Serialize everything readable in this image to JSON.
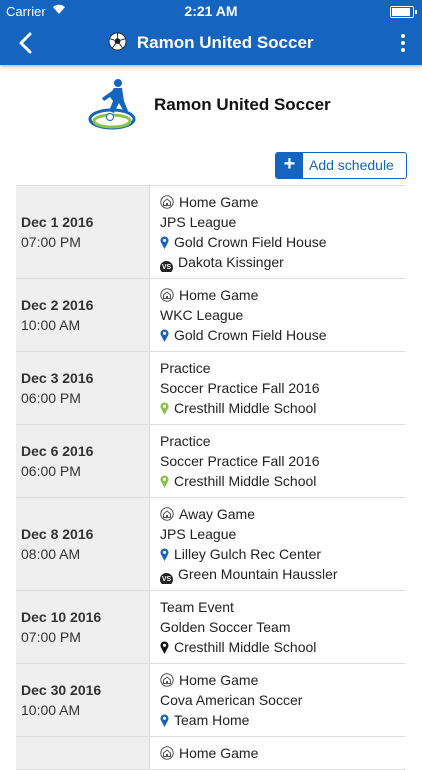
{
  "status_bar": {
    "carrier": "Carrier",
    "time": "2:21 AM"
  },
  "navbar": {
    "title": "Ramon United Soccer"
  },
  "header": {
    "team_name": "Ramon United Soccer"
  },
  "actions": {
    "add_schedule": "Add schedule",
    "add_icon": "+"
  },
  "colors": {
    "brand": "#1565c0",
    "pin_blue": "#1565c0",
    "pin_green": "#8bc34a",
    "pin_black": "#111111"
  },
  "schedule": [
    {
      "date": "Dec 1 2016",
      "time": "07:00 PM",
      "type": "Home Game",
      "type_icon": "home-game-icon",
      "league": "JPS League",
      "location": "Gold Crown Field House",
      "pin": "blue",
      "opponent": "Dakota Kissinger"
    },
    {
      "date": "Dec 2 2016",
      "time": "10:00 AM",
      "type": "Home Game",
      "type_icon": "home-game-icon",
      "league": "WKC League",
      "location": "Gold Crown Field House",
      "pin": "blue",
      "opponent": ""
    },
    {
      "date": "Dec 3 2016",
      "time": "06:00 PM",
      "type": "Practice",
      "type_icon": "",
      "league": "Soccer Practice Fall 2016",
      "location": "Cresthill Middle School",
      "pin": "green",
      "opponent": ""
    },
    {
      "date": "Dec 6 2016",
      "time": "06:00 PM",
      "type": "Practice",
      "type_icon": "",
      "league": "Soccer Practice Fall 2016",
      "location": "Cresthill Middle School",
      "pin": "green",
      "opponent": ""
    },
    {
      "date": "Dec 8 2016",
      "time": "08:00 AM",
      "type": "Away Game",
      "type_icon": "away-game-icon",
      "league": "JPS League",
      "location": "Lilley Gulch Rec Center",
      "pin": "blue",
      "opponent": "Green Mountain Haussler"
    },
    {
      "date": "Dec 10 2016",
      "time": "07:00 PM",
      "type": "Team Event",
      "type_icon": "",
      "league": "Golden Soccer Team",
      "location": "Cresthill Middle School",
      "pin": "black",
      "opponent": ""
    },
    {
      "date": "Dec 30 2016",
      "time": "10:00 AM",
      "type": "Home Game",
      "type_icon": "home-game-icon",
      "league": "Cova American Soccer",
      "location": "Team Home",
      "pin": "blue",
      "opponent": ""
    },
    {
      "date": "",
      "time": "",
      "type": "Home Game",
      "type_icon": "home-game-icon",
      "league": "",
      "location": "",
      "pin": "",
      "opponent": ""
    }
  ],
  "vs_label": "VS"
}
